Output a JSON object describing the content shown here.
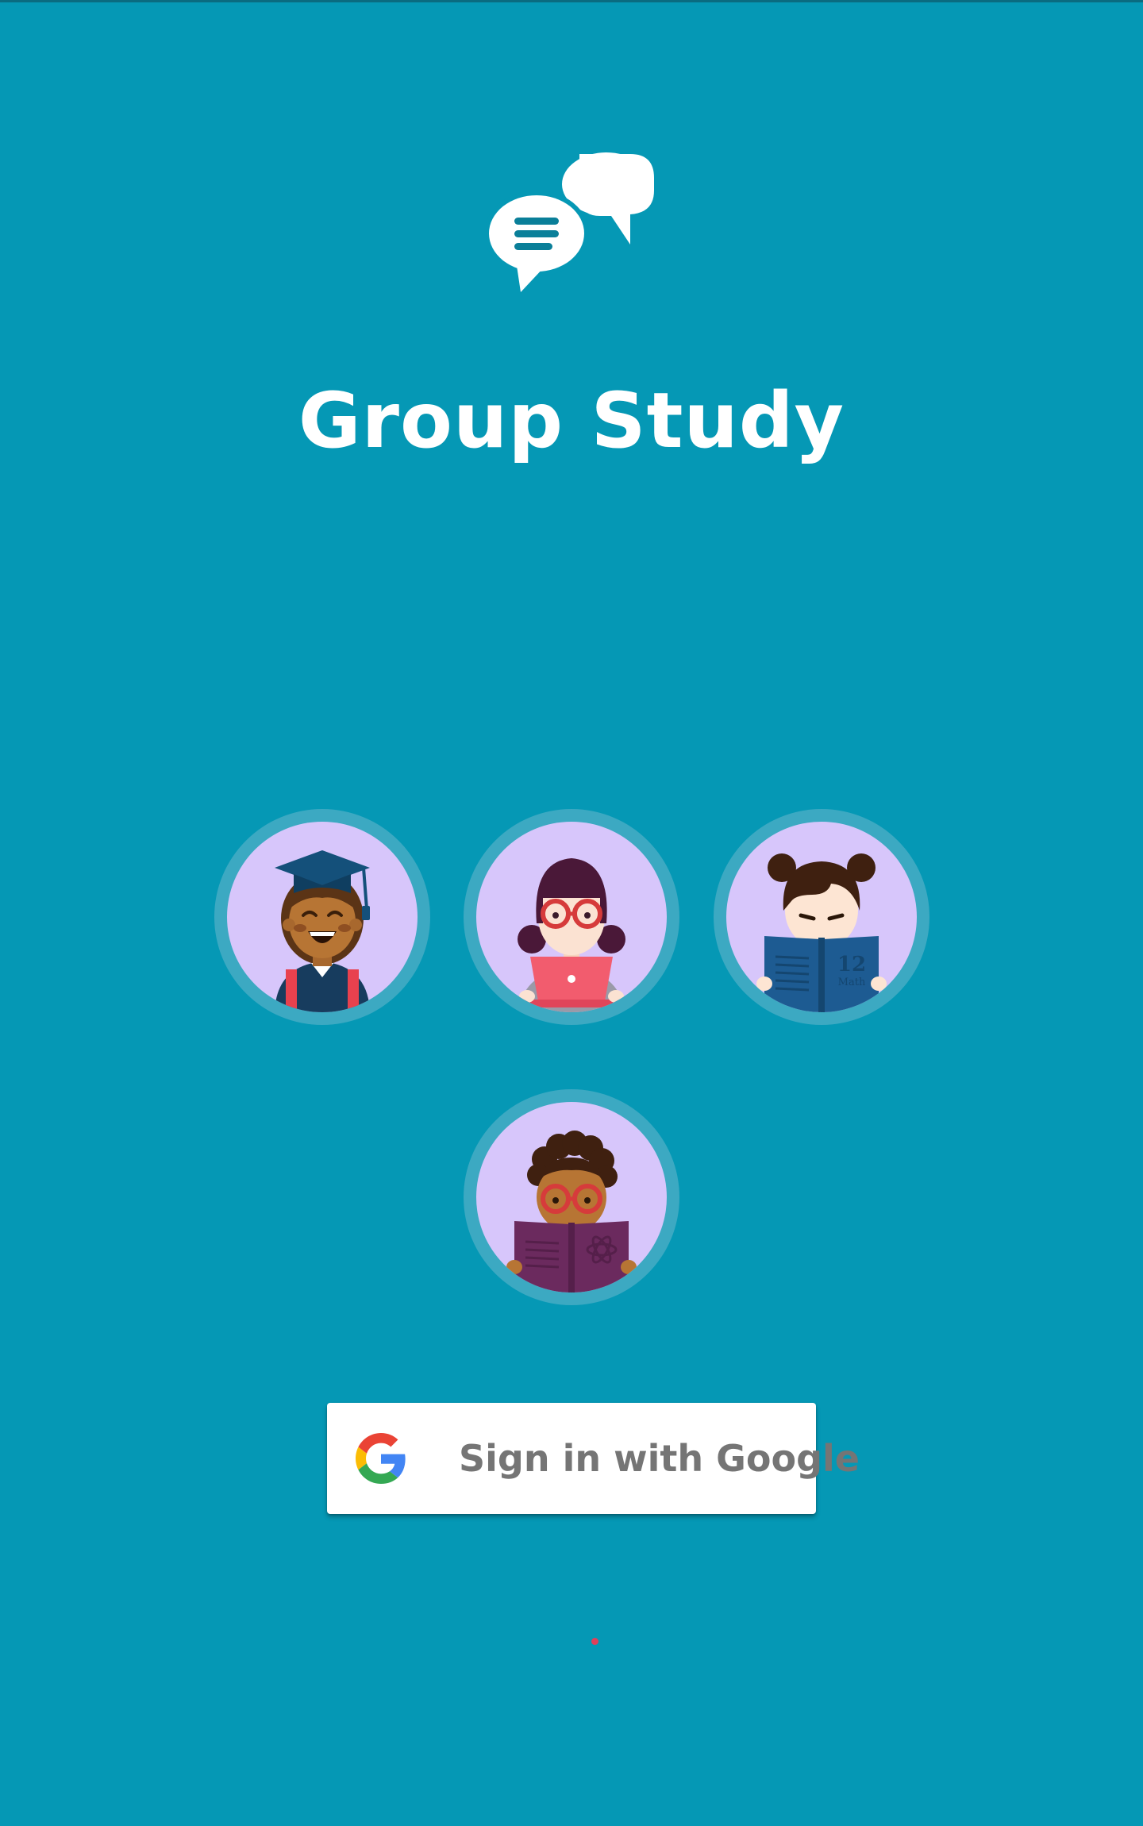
{
  "app": {
    "title": "Group Study",
    "logo_icon": "chat-bubbles-icon"
  },
  "avatars": [
    {
      "name": "graduate-student-avatar",
      "icon": "graduate-icon"
    },
    {
      "name": "laptop-student-avatar",
      "icon": "laptop-girl-icon"
    },
    {
      "name": "math-book-student-avatar",
      "icon": "math-book-girl-icon"
    },
    {
      "name": "science-book-student-avatar",
      "icon": "science-book-boy-icon"
    }
  ],
  "book_labels": {
    "math_number": "12",
    "math_subject": "Math"
  },
  "signin": {
    "label": "Sign in with Google",
    "icon": "google-g-icon"
  },
  "colors": {
    "background": "#0598b5",
    "avatar_ring": "#3ca9c2",
    "avatar_fill": "#d7c6fb",
    "button_text": "#757575",
    "indicator": "#e0405a"
  }
}
